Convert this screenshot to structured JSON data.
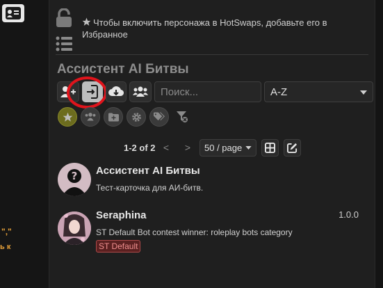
{
  "left": {
    "fragment_a": "\",\"",
    "fragment_b": "ь к"
  },
  "hint": "Чтобы включить персонажа в HotSwaps, добавьте его в Избранное",
  "title": "Ассистент AI Битвы",
  "search": {
    "placeholder": "Поиск..."
  },
  "sort": {
    "value": "A-Z"
  },
  "pagination": {
    "info": "1-2 of 2",
    "prev": "<",
    "next": ">",
    "per_page": "50 / page"
  },
  "characters": [
    {
      "name": "Ассистент AI Битвы",
      "description": "Тест-карточка для АИ-битв.",
      "version": "",
      "tag": ""
    },
    {
      "name": "Seraphina",
      "description": "ST Default Bot contest winner: roleplay bots category",
      "version": "1.0.0",
      "tag": "ST Default"
    }
  ],
  "colors": {
    "highlight": "#e0141c",
    "tag": "#f09090",
    "fav": "#6c6c1e"
  },
  "icons": [
    "user-card-icon",
    "lock-open-icon",
    "list-icon",
    "star-icon",
    "add-user-icon",
    "import-file-icon",
    "download-icon",
    "group-icon",
    "users-icon",
    "folder-plus-icon",
    "gear-icon",
    "tags-icon",
    "filter-clear-icon",
    "grid-icon",
    "edit-icon"
  ]
}
